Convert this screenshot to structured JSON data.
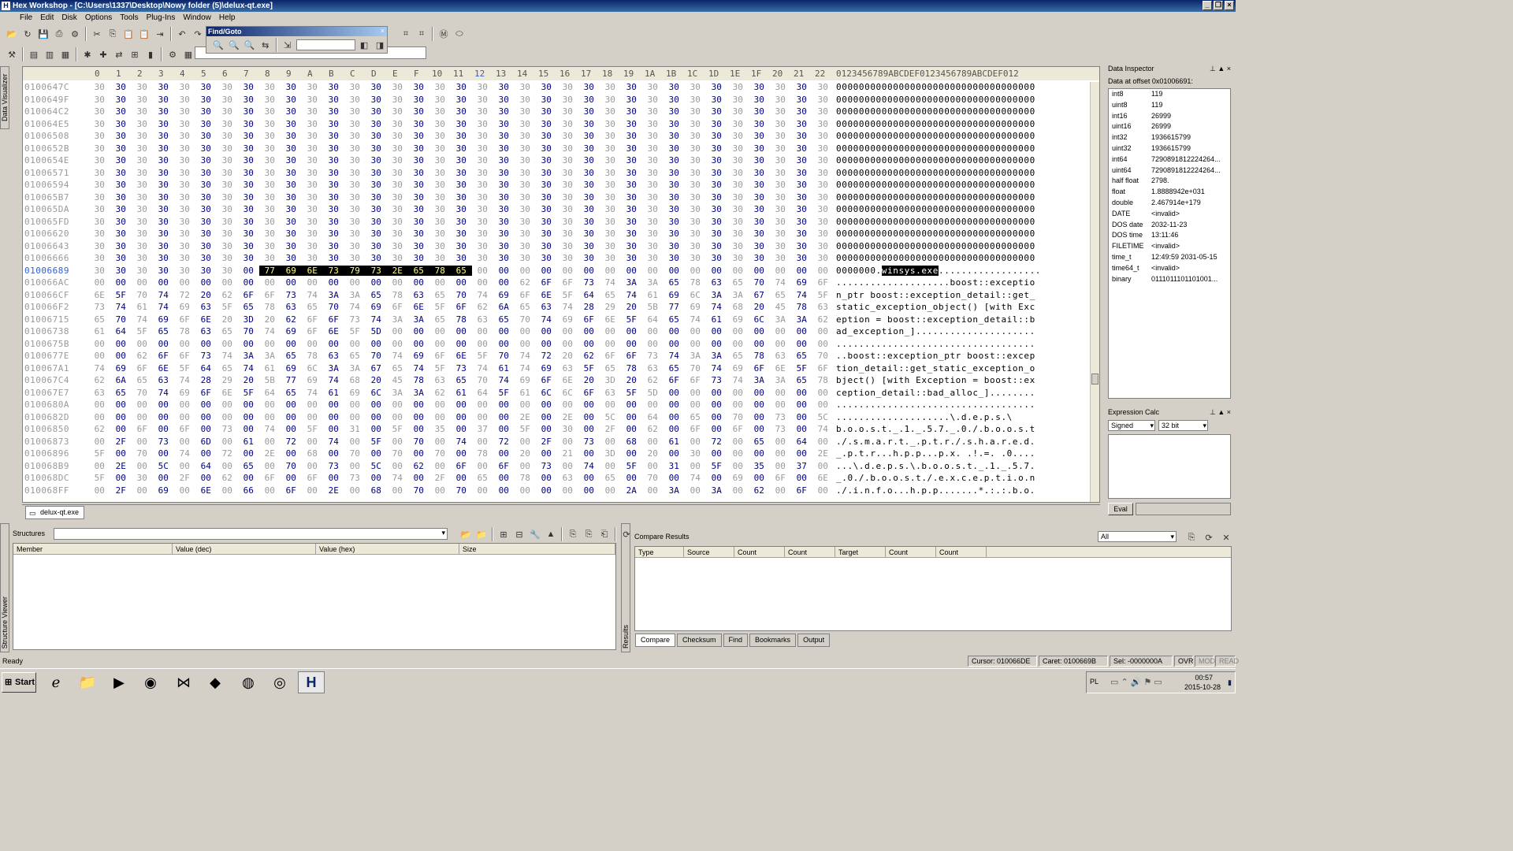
{
  "window": {
    "title": "Hex Workshop - [C:\\Users\\1337\\Desktop\\Nowy folder (5)\\delux-qt.exe]"
  },
  "menu": [
    "File",
    "Edit",
    "Disk",
    "Options",
    "Tools",
    "Plug-Ins",
    "Window",
    "Help"
  ],
  "findgoto": {
    "title": "Find/Goto"
  },
  "hex_header": {
    "columns": [
      "0",
      "1",
      "2",
      "3",
      "4",
      "5",
      "6",
      "7",
      "8",
      "9",
      "A",
      "B",
      "C",
      "D",
      "E",
      "F",
      "10",
      "11",
      "12",
      "13",
      "14",
      "15",
      "16",
      "17",
      "18",
      "19",
      "1A",
      "1B",
      "1C",
      "1D",
      "1E",
      "1F",
      "20",
      "21",
      "22"
    ],
    "ascii_header": "0123456789ABCDEF0123456789ABCDEF012"
  },
  "hex_rows": [
    {
      "off": "0100647C",
      "bytes": "30 30 30 30 30 30 30 30 30 30 30 30 30 30 30 30 30 30 30 30 30 30 30 30 30 30 30 30 30 30 30 30 30 30 30",
      "ascii": "00000000000000000000000000000000000"
    },
    {
      "off": "0100649F",
      "bytes": "30 30 30 30 30 30 30 30 30 30 30 30 30 30 30 30 30 30 30 30 30 30 30 30 30 30 30 30 30 30 30 30 30 30 30",
      "ascii": "00000000000000000000000000000000000"
    },
    {
      "off": "010064C2",
      "bytes": "30 30 30 30 30 30 30 30 30 30 30 30 30 30 30 30 30 30 30 30 30 30 30 30 30 30 30 30 30 30 30 30 30 30 30",
      "ascii": "00000000000000000000000000000000000"
    },
    {
      "off": "010064E5",
      "bytes": "30 30 30 30 30 30 30 30 30 30 30 30 30 30 30 30 30 30 30 30 30 30 30 30 30 30 30 30 30 30 30 30 30 30 30",
      "ascii": "00000000000000000000000000000000000"
    },
    {
      "off": "01006508",
      "bytes": "30 30 30 30 30 30 30 30 30 30 30 30 30 30 30 30 30 30 30 30 30 30 30 30 30 30 30 30 30 30 30 30 30 30 30",
      "ascii": "00000000000000000000000000000000000"
    },
    {
      "off": "0100652B",
      "bytes": "30 30 30 30 30 30 30 30 30 30 30 30 30 30 30 30 30 30 30 30 30 30 30 30 30 30 30 30 30 30 30 30 30 30 30",
      "ascii": "00000000000000000000000000000000000"
    },
    {
      "off": "0100654E",
      "bytes": "30 30 30 30 30 30 30 30 30 30 30 30 30 30 30 30 30 30 30 30 30 30 30 30 30 30 30 30 30 30 30 30 30 30 30",
      "ascii": "00000000000000000000000000000000000"
    },
    {
      "off": "01006571",
      "bytes": "30 30 30 30 30 30 30 30 30 30 30 30 30 30 30 30 30 30 30 30 30 30 30 30 30 30 30 30 30 30 30 30 30 30 30",
      "ascii": "00000000000000000000000000000000000"
    },
    {
      "off": "01006594",
      "bytes": "30 30 30 30 30 30 30 30 30 30 30 30 30 30 30 30 30 30 30 30 30 30 30 30 30 30 30 30 30 30 30 30 30 30 30",
      "ascii": "00000000000000000000000000000000000"
    },
    {
      "off": "010065B7",
      "bytes": "30 30 30 30 30 30 30 30 30 30 30 30 30 30 30 30 30 30 30 30 30 30 30 30 30 30 30 30 30 30 30 30 30 30 30",
      "ascii": "00000000000000000000000000000000000"
    },
    {
      "off": "010065DA",
      "bytes": "30 30 30 30 30 30 30 30 30 30 30 30 30 30 30 30 30 30 30 30 30 30 30 30 30 30 30 30 30 30 30 30 30 30 30",
      "ascii": "00000000000000000000000000000000000"
    },
    {
      "off": "010065FD",
      "bytes": "30 30 30 30 30 30 30 30 30 30 30 30 30 30 30 30 30 30 30 30 30 30 30 30 30 30 30 30 30 30 30 30 30 30 30",
      "ascii": "00000000000000000000000000000000000"
    },
    {
      "off": "01006620",
      "bytes": "30 30 30 30 30 30 30 30 30 30 30 30 30 30 30 30 30 30 30 30 30 30 30 30 30 30 30 30 30 30 30 30 30 30 30",
      "ascii": "00000000000000000000000000000000000"
    },
    {
      "off": "01006643",
      "bytes": "30 30 30 30 30 30 30 30 30 30 30 30 30 30 30 30 30 30 30 30 30 30 30 30 30 30 30 30 30 30 30 30 30 30 30",
      "ascii": "00000000000000000000000000000000000"
    },
    {
      "off": "01006666",
      "bytes": "30 30 30 30 30 30 30 30 30 30 30 30 30 30 30 30 30 30 30 30 30 30 30 30 30 30 30 30 30 30 30 30 30 30 30",
      "ascii": "00000000000000000000000000000000000"
    },
    {
      "off": "01006689",
      "bytes": "30 30 30 30 30 30 30 00 77 69 6E 73 79 73 2E 65 78 65 00 00 00 00 00 00 00 00 00 00 00 00 00 00 00 00 00",
      "ascii_pre": "0000000.",
      "ascii_hl": "winsys.exe",
      "ascii_post": "..................",
      "sel": true,
      "hl_from": 8,
      "hl_to": 17
    },
    {
      "off": "010066AC",
      "bytes": "00 00 00 00 00 00 00 00 00 00 00 00 00 00 00 00 00 00 00 00 62 6F 6F 73 74 3A 3A 65 78 63 65 70 74 69 6F",
      "ascii": "....................boost::exceptio"
    },
    {
      "off": "010066CF",
      "bytes": "6E 5F 70 74 72 20 62 6F 6F 73 74 3A 3A 65 78 63 65 70 74 69 6F 6E 5F 64 65 74 61 69 6C 3A 3A 67 65 74 5F",
      "ascii": "n_ptr boost::exception_detail::get_"
    },
    {
      "off": "010066F2",
      "bytes": "73 74 61 74 69 63 5F 65 78 63 65 70 74 69 6F 6E 5F 6F 62 6A 65 63 74 28 29 20 5B 77 69 74 68 20 45 78 63",
      "ascii": "static_exception_object() [with Exc"
    },
    {
      "off": "01006715",
      "bytes": "65 70 74 69 6F 6E 20 3D 20 62 6F 6F 73 74 3A 3A 65 78 63 65 70 74 69 6F 6E 5F 64 65 74 61 69 6C 3A 3A 62",
      "ascii": "eption = boost::exception_detail::b"
    },
    {
      "off": "01006738",
      "bytes": "61 64 5F 65 78 63 65 70 74 69 6F 6E 5F 5D 00 00 00 00 00 00 00 00 00 00 00 00 00 00 00 00 00 00 00 00 00",
      "ascii": "ad_exception_]....................."
    },
    {
      "off": "0100675B",
      "bytes": "00 00 00 00 00 00 00 00 00 00 00 00 00 00 00 00 00 00 00 00 00 00 00 00 00 00 00 00 00 00 00 00 00 00 00",
      "ascii": "..................................."
    },
    {
      "off": "0100677E",
      "bytes": "00 00 62 6F 6F 73 74 3A 3A 65 78 63 65 70 74 69 6F 6E 5F 70 74 72 20 62 6F 6F 73 74 3A 3A 65 78 63 65 70",
      "ascii": "..boost::exception_ptr boost::excep"
    },
    {
      "off": "010067A1",
      "bytes": "74 69 6F 6E 5F 64 65 74 61 69 6C 3A 3A 67 65 74 5F 73 74 61 74 69 63 5F 65 78 63 65 70 74 69 6F 6E 5F 6F",
      "ascii": "tion_detail::get_static_exception_o"
    },
    {
      "off": "010067C4",
      "bytes": "62 6A 65 63 74 28 29 20 5B 77 69 74 68 20 45 78 63 65 70 74 69 6F 6E 20 3D 20 62 6F 6F 73 74 3A 3A 65 78",
      "ascii": "bject() [with Exception = boost::ex"
    },
    {
      "off": "010067E7",
      "bytes": "63 65 70 74 69 6F 6E 5F 64 65 74 61 69 6C 3A 3A 62 61 64 5F 61 6C 6C 6F 63 5F 5D 00 00 00 00 00 00 00 00",
      "ascii": "ception_detail::bad_alloc_]........"
    },
    {
      "off": "0100680A",
      "bytes": "00 00 00 00 00 00 00 00 00 00 00 00 00 00 00 00 00 00 00 00 00 00 00 00 00 00 00 00 00 00 00 00 00 00 00",
      "ascii": "..................................."
    },
    {
      "off": "0100682D",
      "bytes": "00 00 00 00 00 00 00 00 00 00 00 00 00 00 00 00 00 00 00 00 2E 00 2E 00 5C 00 64 00 65 00 70 00 73 00 5C",
      "ascii": "....................\\.d.e.p.s.\\"
    },
    {
      "off": "01006850",
      "bytes": "62 00 6F 00 6F 00 73 00 74 00 5F 00 31 00 5F 00 35 00 37 00 5F 00 30 00 2F 00 62 00 6F 00 6F 00 73 00 74",
      "ascii": "b.o.o.s.t._.1._.5.7._.0./.b.o.o.s.t"
    },
    {
      "off": "01006873",
      "bytes": "00 2F 00 73 00 6D 00 61 00 72 00 74 00 5F 00 70 00 74 00 72 00 2F 00 73 00 68 00 61 00 72 00 65 00 64 00",
      "ascii": "./.s.m.a.r.t._.p.t.r./.s.h.a.r.e.d."
    },
    {
      "off": "01006896",
      "bytes": "5F 00 70 00 74 00 72 00 2E 00 68 00 70 00 70 00 70 00 78 00 20 00 21 00 3D 00 20 00 30 00 00 00 00 00 2E",
      "ascii": "_.p.t.r...h.p.p...p.x. .!.=. .0...."
    },
    {
      "off": "010068B9",
      "bytes": "00 2E 00 5C 00 64 00 65 00 70 00 73 00 5C 00 62 00 6F 00 6F 00 73 00 74 00 5F 00 31 00 5F 00 35 00 37 00",
      "ascii": "...\\.d.e.p.s.\\.b.o.o.s.t._.1._.5.7."
    },
    {
      "off": "010068DC",
      "bytes": "5F 00 30 00 2F 00 62 00 6F 00 6F 00 73 00 74 00 2F 00 65 00 78 00 63 00 65 00 70 00 74 00 69 00 6F 00 6E",
      "ascii": "_.0./.b.o.o.s.t./.e.x.c.e.p.t.i.o.n"
    },
    {
      "off": "010068FF",
      "bytes": "00 2F 00 69 00 6E 00 66 00 6F 00 2E 00 68 00 70 00 70 00 00 00 00 00 00 00 2A 00 3A 00 3A 00 62 00 6F 00",
      "ascii": "./.i.n.f.o...h.p.p.......*.:.:.b.o."
    }
  ],
  "file_tab": "delux-qt.exe",
  "left_tab": "Data Visualizer",
  "structure_tab": "Structure Viewer",
  "results_tab": "Results",
  "inspector": {
    "title": "Data Inspector",
    "offset_label": "Data at offset 0x01006691:",
    "rows": [
      {
        "k": "int8",
        "v": "119"
      },
      {
        "k": "uint8",
        "v": "119"
      },
      {
        "k": "int16",
        "v": "26999"
      },
      {
        "k": "uint16",
        "v": "26999"
      },
      {
        "k": "int32",
        "v": "1936615799"
      },
      {
        "k": "uint32",
        "v": "1936615799"
      },
      {
        "k": "int64",
        "v": "7290891812224264..."
      },
      {
        "k": "uint64",
        "v": "7290891812224264..."
      },
      {
        "k": "half float",
        "v": "2798."
      },
      {
        "k": "float",
        "v": "1.8888942e+031"
      },
      {
        "k": "double",
        "v": "2.467914e+179"
      },
      {
        "k": "DATE",
        "v": "<invalid>"
      },
      {
        "k": "DOS date",
        "v": "2032-11-23"
      },
      {
        "k": "DOS time",
        "v": "13:11:46"
      },
      {
        "k": "FILETIME",
        "v": "<invalid>"
      },
      {
        "k": "time_t",
        "v": "12:49:59 2031-05-15"
      },
      {
        "k": "time64_t",
        "v": "<invalid>"
      },
      {
        "k": "binary",
        "v": "0111011101101001..."
      }
    ]
  },
  "expr": {
    "title": "Expression Calc",
    "signed": "Signed",
    "bits": "32 bit",
    "eval": "Eval"
  },
  "structures": {
    "label": "Structures",
    "cols": [
      "Member",
      "Value (dec)",
      "Value (hex)",
      "Size"
    ]
  },
  "compare": {
    "title": "Compare Results",
    "filter": "All",
    "cols": [
      "Type",
      "Source",
      "Count",
      "Count",
      "Target",
      "Count",
      "Count"
    ]
  },
  "bottom_tabs": [
    "Compare",
    "Checksum",
    "Find",
    "Bookmarks",
    "Output"
  ],
  "status": {
    "ready": "Ready",
    "cursor": "Cursor: 010066DE",
    "caret": "Caret: 0100669B",
    "sel": "Sel: -0000000A",
    "ovr": "OVR",
    "mod": "MOD",
    "read": "READ"
  },
  "taskbar": {
    "start": "Start",
    "lang": "PL",
    "time": "00:57",
    "date": "2015-10-28"
  }
}
